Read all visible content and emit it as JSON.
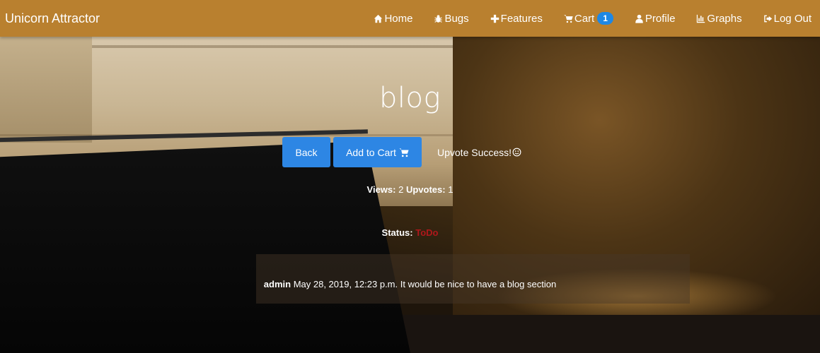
{
  "navbar": {
    "brand": "Unicorn Attractor",
    "items": [
      {
        "label": "Home",
        "icon": "home-icon"
      },
      {
        "label": "Bugs",
        "icon": "bug-icon"
      },
      {
        "label": "Features",
        "icon": "plus-icon"
      },
      {
        "label": "Cart",
        "icon": "cart-icon",
        "badge": "1"
      },
      {
        "label": "Profile",
        "icon": "user-icon"
      },
      {
        "label": "Graphs",
        "icon": "bar-chart-icon"
      },
      {
        "label": "Log Out",
        "icon": "sign-out-icon"
      }
    ]
  },
  "page": {
    "title": "blog",
    "back_label": "Back",
    "add_to_cart_label": "Add to Cart",
    "upvote_message": "Upvote Success!"
  },
  "stats": {
    "views_label": "Views:",
    "views_value": "2",
    "upvotes_label": "Upvotes:",
    "upvotes_value": "1"
  },
  "status": {
    "label": "Status:",
    "value": "ToDo"
  },
  "comment": {
    "author": "admin",
    "timestamp": "May 28, 2019, 12:23 p.m.",
    "text": "It would be nice to have a blog section"
  },
  "colors": {
    "navbar": "#b9802f",
    "button": "#2d86e4",
    "badge": "#1e88e5",
    "status_todo": "#b0171b"
  }
}
